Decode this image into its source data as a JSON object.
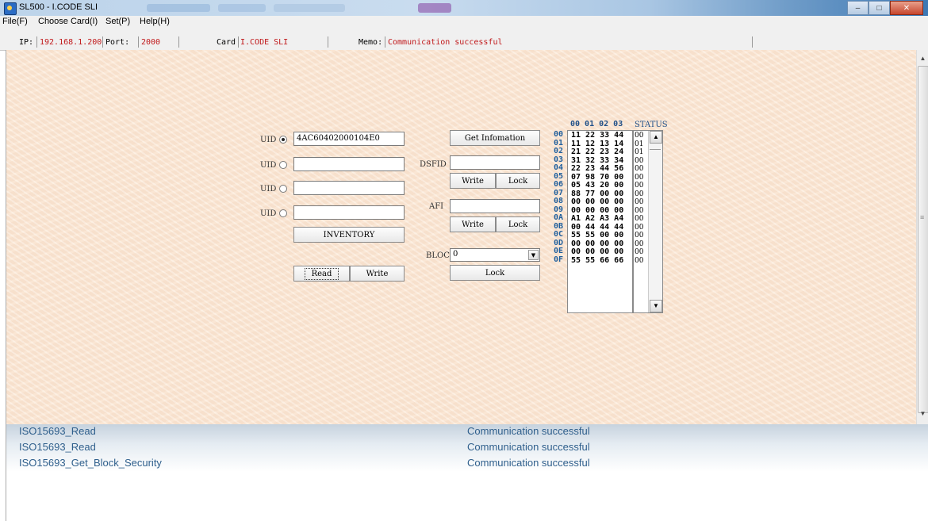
{
  "window": {
    "title": "SL500 - I.CODE SLI",
    "controls": {
      "minimize": "‒",
      "maximize": "□",
      "close": "✕"
    }
  },
  "menu": [
    "File(F)",
    "Choose Card(I)",
    "Set(P)",
    "Help(H)"
  ],
  "infobar": {
    "ip_label": "IP:",
    "ip": "192.168.1.200",
    "port_label": "Port:",
    "port": "2000",
    "card_label": "Card",
    "card": "I.CODE SLI",
    "memo_label": "Memo:",
    "memo": "Communication successful"
  },
  "uid": {
    "label": "UID",
    "values": [
      "4AC60402000104E0",
      "",
      "",
      ""
    ],
    "selected_index": 0
  },
  "buttons": {
    "inventory": "INVENTORY",
    "read": "Read",
    "write": "Write",
    "get_info": "Get Infomation",
    "dsfid_write": "Write",
    "dsfid_lock": "Lock",
    "afi_write": "Write",
    "afi_lock": "Lock",
    "block_lock": "Lock"
  },
  "fields": {
    "dsfid_label": "DSFID",
    "dsfid": "",
    "afi_label": "AFI",
    "afi": "",
    "block_label": "BLOCK",
    "block": "0"
  },
  "grid": {
    "col_header": "00 01 02 03",
    "status_header": "STATUS",
    "rows": [
      {
        "addr": "00",
        "data": "11 22 33 44",
        "status": "00"
      },
      {
        "addr": "01",
        "data": "11 12 13 14",
        "status": "01"
      },
      {
        "addr": "02",
        "data": "21 22 23 24",
        "status": "01"
      },
      {
        "addr": "03",
        "data": "31 32 33 34",
        "status": "00"
      },
      {
        "addr": "04",
        "data": "22 23 44 56",
        "status": "00"
      },
      {
        "addr": "05",
        "data": "07 98 70 00",
        "status": "00"
      },
      {
        "addr": "06",
        "data": "05 43 20 00",
        "status": "00"
      },
      {
        "addr": "07",
        "data": "88 77 00 00",
        "status": "00"
      },
      {
        "addr": "08",
        "data": "00 00 00 00",
        "status": "00"
      },
      {
        "addr": "09",
        "data": "00 00 00 00",
        "status": "00"
      },
      {
        "addr": "0A",
        "data": "A1 A2 A3 A4",
        "status": "00"
      },
      {
        "addr": "0B",
        "data": "00 44 44 44",
        "status": "00"
      },
      {
        "addr": "0C",
        "data": "55 55 00 00",
        "status": "00"
      },
      {
        "addr": "0D",
        "data": "00 00 00 00",
        "status": "00"
      },
      {
        "addr": "0E",
        "data": "00 00 00 00",
        "status": "00"
      },
      {
        "addr": "0F",
        "data": "55 55 66 66",
        "status": "00"
      }
    ]
  },
  "log": [
    {
      "command": "ISO15693_Read",
      "result": "Communication successful"
    },
    {
      "command": "ISO15693_Read",
      "result": "Communication successful"
    },
    {
      "command": "ISO15693_Get_Block_Security",
      "result": "Communication successful"
    }
  ],
  "colors": {
    "panel_bg": "#fbe7d4",
    "value_red": "#c0181a",
    "log_blue": "#2f5f8c"
  }
}
